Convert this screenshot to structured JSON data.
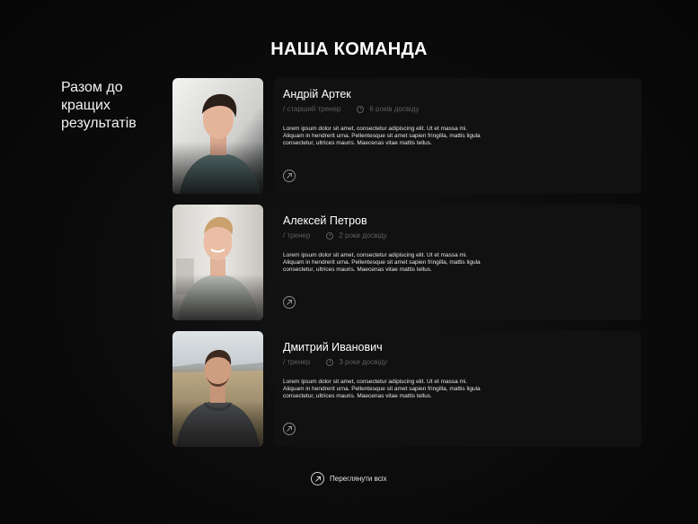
{
  "page": {
    "title": "НАША КОМАНДА",
    "tagline": "Разом до кращих результатів"
  },
  "team": [
    {
      "name": "Андрій Артек",
      "role": "/ старший тренер",
      "experience": "6 років досвіду",
      "description": "Lorem ipsum dolor sit amet, consectetur adipiscing elit. Ut et massa mi. Aliquam in hendrerit urna. Pellentesque sit amet sapien fringilla, mattis ligula consectetur, ultrices mauris. Maecenas vitae mattis tellus."
    },
    {
      "name": "Алексей Петров",
      "role": "/ тренер",
      "experience": "2 роки досвіду",
      "description": "Lorem ipsum dolor sit amet, consectetur adipiscing elit. Ut et massa mi. Aliquam in hendrerit urna. Pellentesque sit amet sapien fringilla, mattis ligula consectetur, ultrices mauris. Maecenas vitae mattis tellus."
    },
    {
      "name": "Дмитрий Иванович",
      "role": "/ тренер",
      "experience": "3 роки досвіду",
      "description": "Lorem ipsum dolor sit amet, consectetur adipiscing elit. Ut et massa mi. Aliquam in hendrerit urna. Pellentesque sit amet sapien fringilla, mattis ligula consectetur, ultrices mauris. Maecenas vitae mattis tellus."
    }
  ],
  "view_all": {
    "label": "Переглянути всіх",
    "icon": "arrow-up-right-icon"
  },
  "colors": {
    "background": "#080808",
    "card": "#111111",
    "muted_text": "#5e5e5e",
    "text": "#ffffff"
  }
}
